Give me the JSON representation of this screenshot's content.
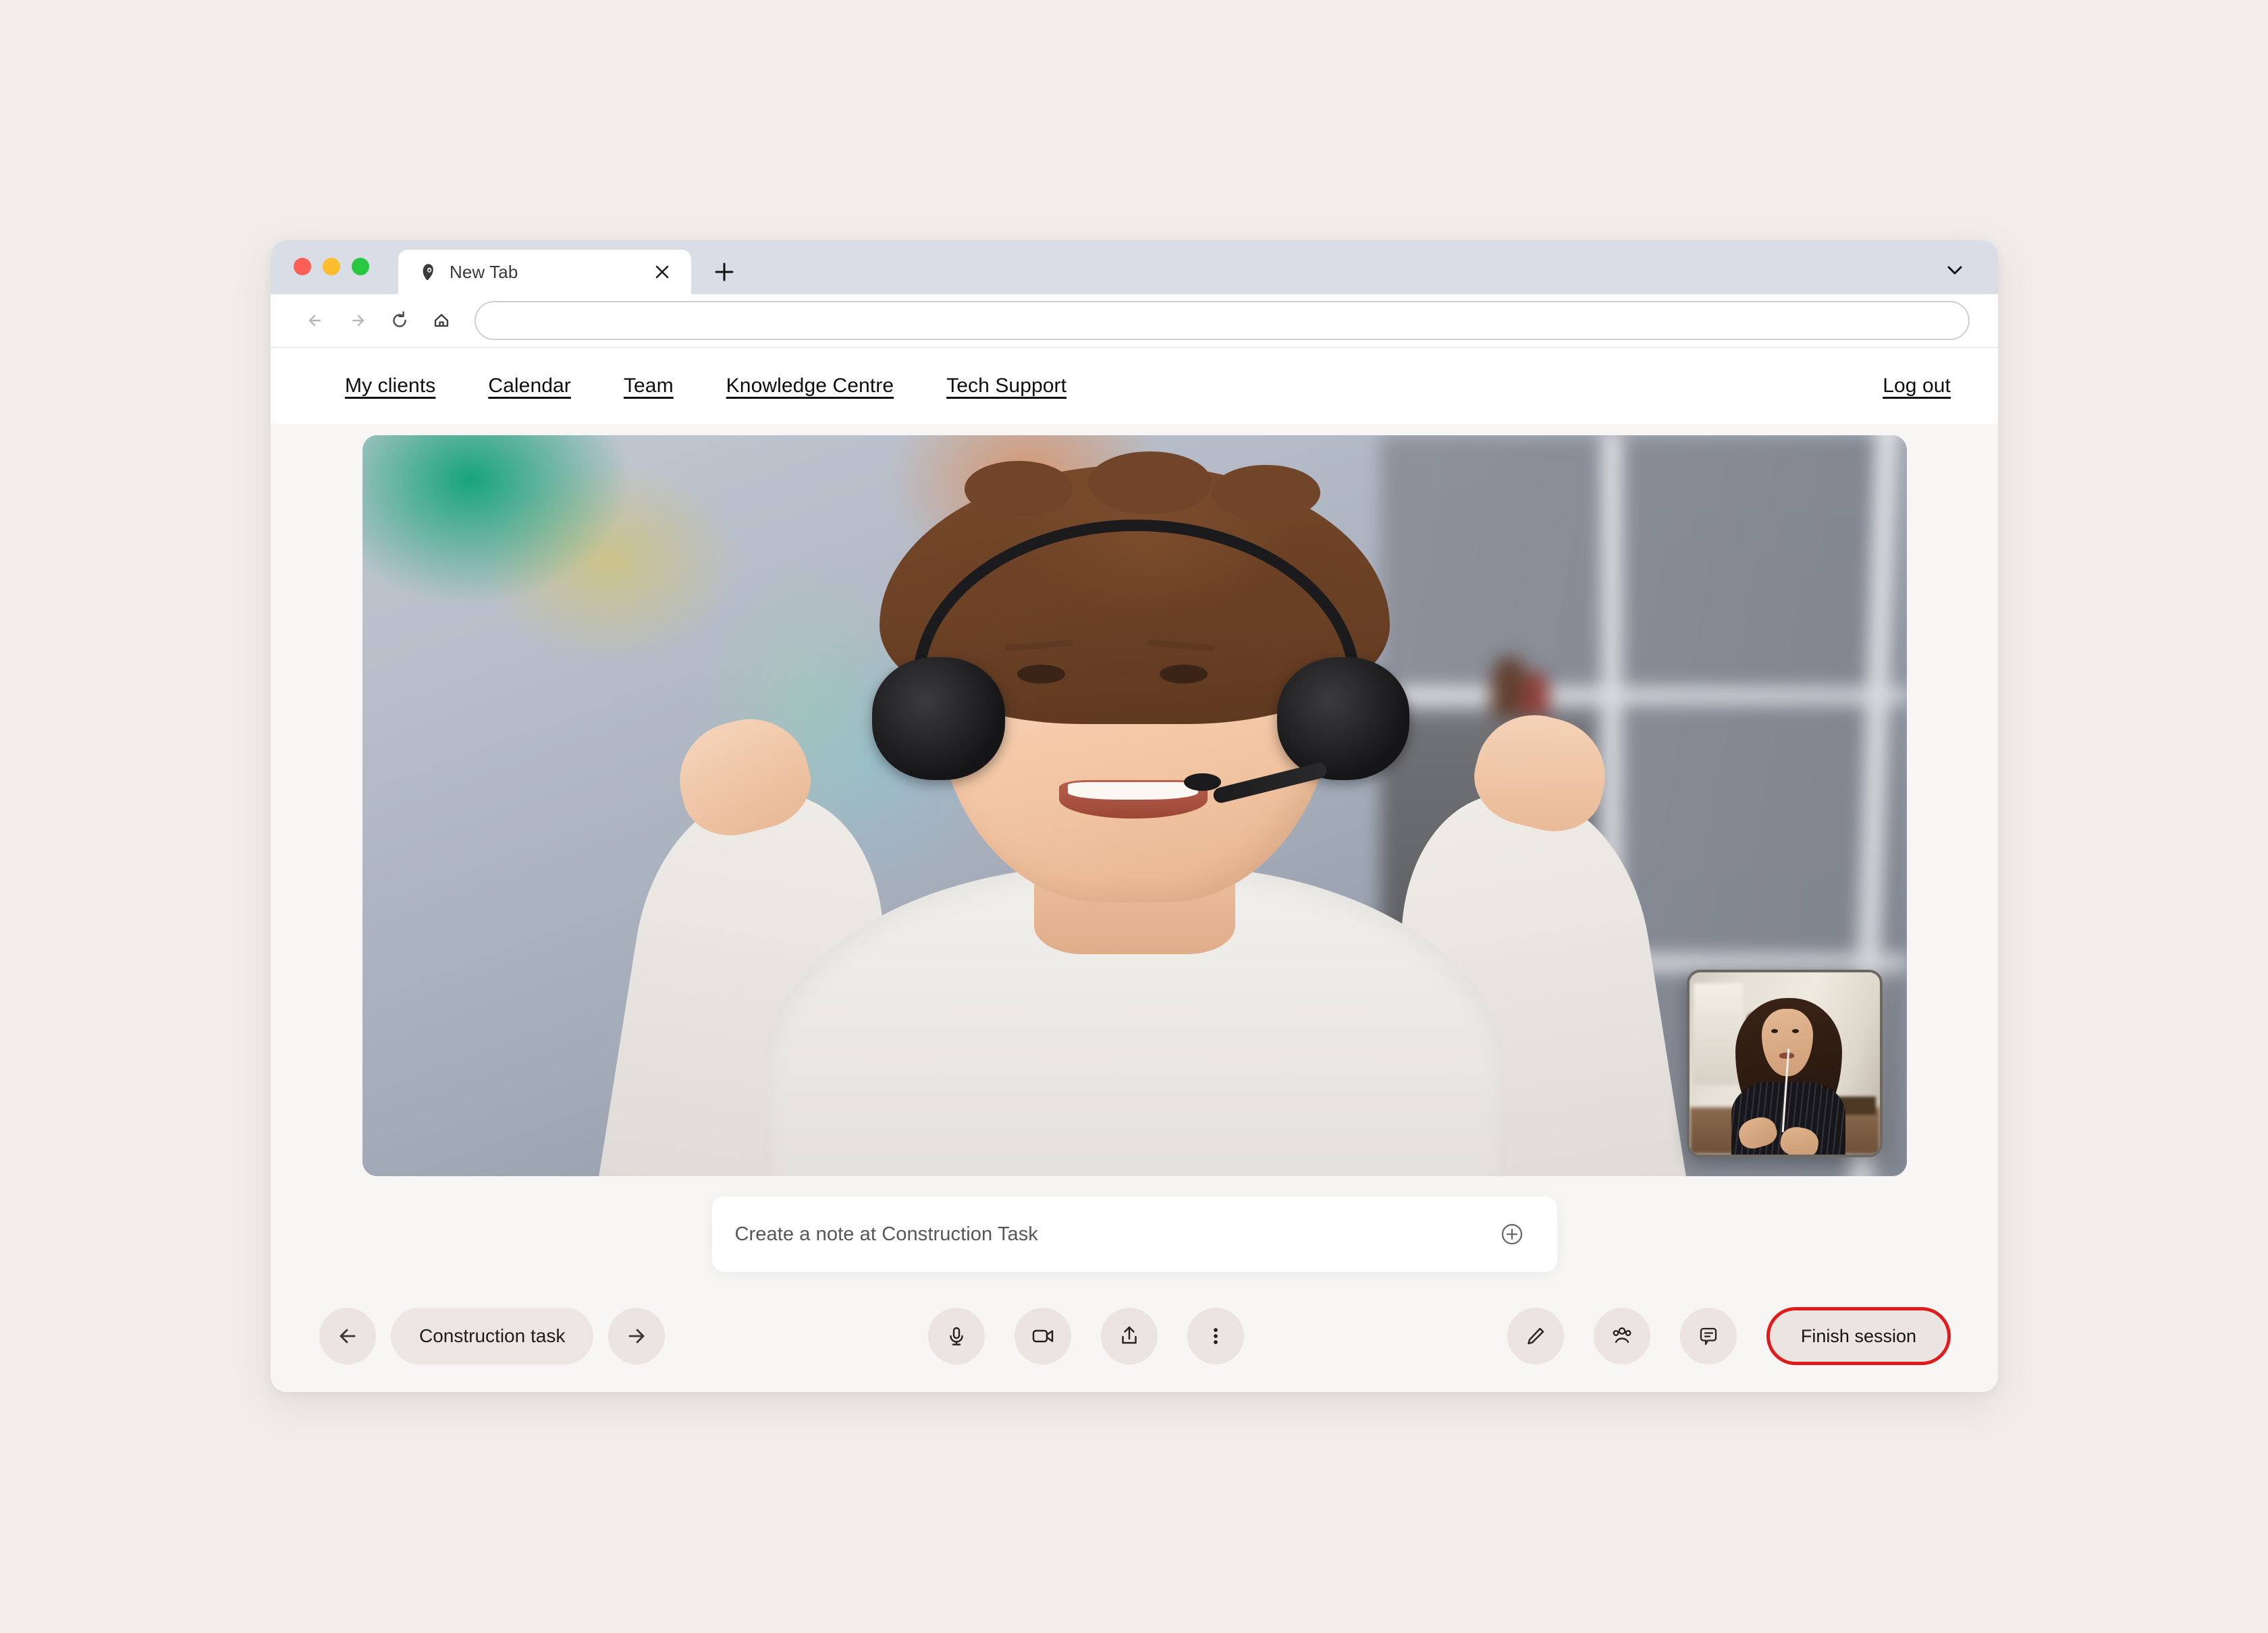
{
  "browser": {
    "traffic_lights": [
      "close",
      "minimize",
      "maximize"
    ],
    "tab": {
      "title": "New Tab",
      "favicon": "app-logo-icon",
      "close_icon": "close-icon"
    },
    "new_tab_icon": "plus-icon",
    "tabstrip_chevron_icon": "chevron-down-icon",
    "toolbar": {
      "back_icon": "arrow-left-icon",
      "forward_icon": "arrow-right-icon",
      "reload_icon": "reload-icon",
      "home_icon": "home-icon",
      "url_value": "",
      "url_placeholder": ""
    }
  },
  "app_nav": {
    "links": [
      {
        "label": "My clients"
      },
      {
        "label": "Calendar"
      },
      {
        "label": "Team"
      },
      {
        "label": "Knowledge Centre"
      },
      {
        "label": "Tech Support"
      }
    ],
    "logout_label": "Log out"
  },
  "session": {
    "main_video_alt": "child-with-headphones-video",
    "self_view_alt": "therapist-self-view-video"
  },
  "note": {
    "placeholder": "Create a note at Construction Task",
    "value": "",
    "add_icon": "plus-circle-icon"
  },
  "controls": {
    "prev_icon": "arrow-left-icon",
    "task_label": "Construction task",
    "next_icon": "arrow-right-icon",
    "mic_icon": "microphone-icon",
    "camera_icon": "video-camera-icon",
    "share_icon": "share-upload-icon",
    "more_icon": "more-vertical-icon",
    "draw_icon": "pencil-icon",
    "participants_icon": "people-icon",
    "chat_icon": "chat-bubble-icon",
    "finish_label": "Finish session"
  },
  "colors": {
    "page_background": "#f0edeb",
    "app_background": "#f8f6f4",
    "tabstrip": "#d9dde5",
    "button_fill": "#ece4e1",
    "danger": "#e01b1b",
    "traffic_red": "#ff5f57",
    "traffic_yellow": "#febc2e",
    "traffic_green": "#28c840"
  }
}
